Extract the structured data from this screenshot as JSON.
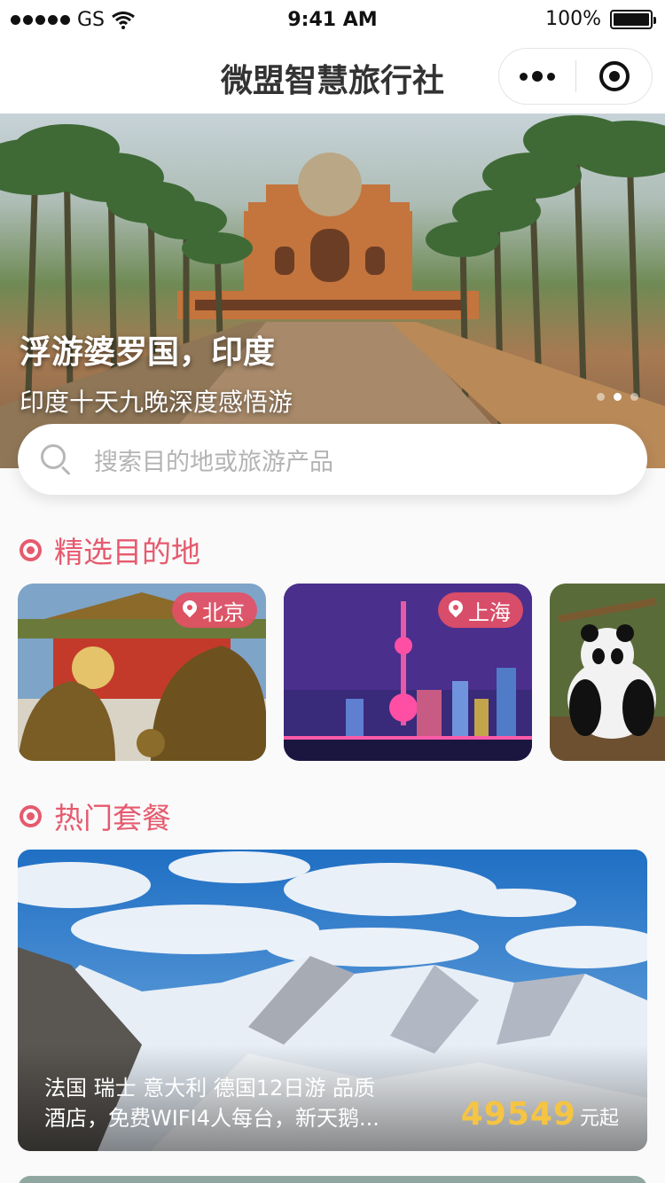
{
  "status_bar": {
    "carrier": "GS",
    "time": "9:41 AM",
    "battery": "100%",
    "battery_level": 1.0
  },
  "nav": {
    "title": "微盟智慧旅行社"
  },
  "banner": {
    "title": "浮游婆罗国，印度",
    "subtitle": "印度十天九晚深度感悟游",
    "dot_count": 3,
    "active_dot": 1
  },
  "search": {
    "placeholder": "搜索目的地或旅游产品"
  },
  "destinations": {
    "title": "精选目的地",
    "items": [
      {
        "label": "北京",
        "icon": "location-pin-icon"
      },
      {
        "label": "上海",
        "icon": "location-pin-icon"
      },
      {
        "label": "",
        "icon": "location-pin-icon"
      }
    ]
  },
  "packages": {
    "title": "热门套餐",
    "items": [
      {
        "desc_line1": "法国 瑞士 意大利 德国12日游 品质",
        "desc_line2": "酒店，免费WIFI4人每台，新天鹅...",
        "price": "49549",
        "price_unit": "元起"
      }
    ]
  },
  "colors": {
    "accent": "#e65a6e",
    "price": "#f6c443",
    "tag_bg": "#e45066"
  }
}
